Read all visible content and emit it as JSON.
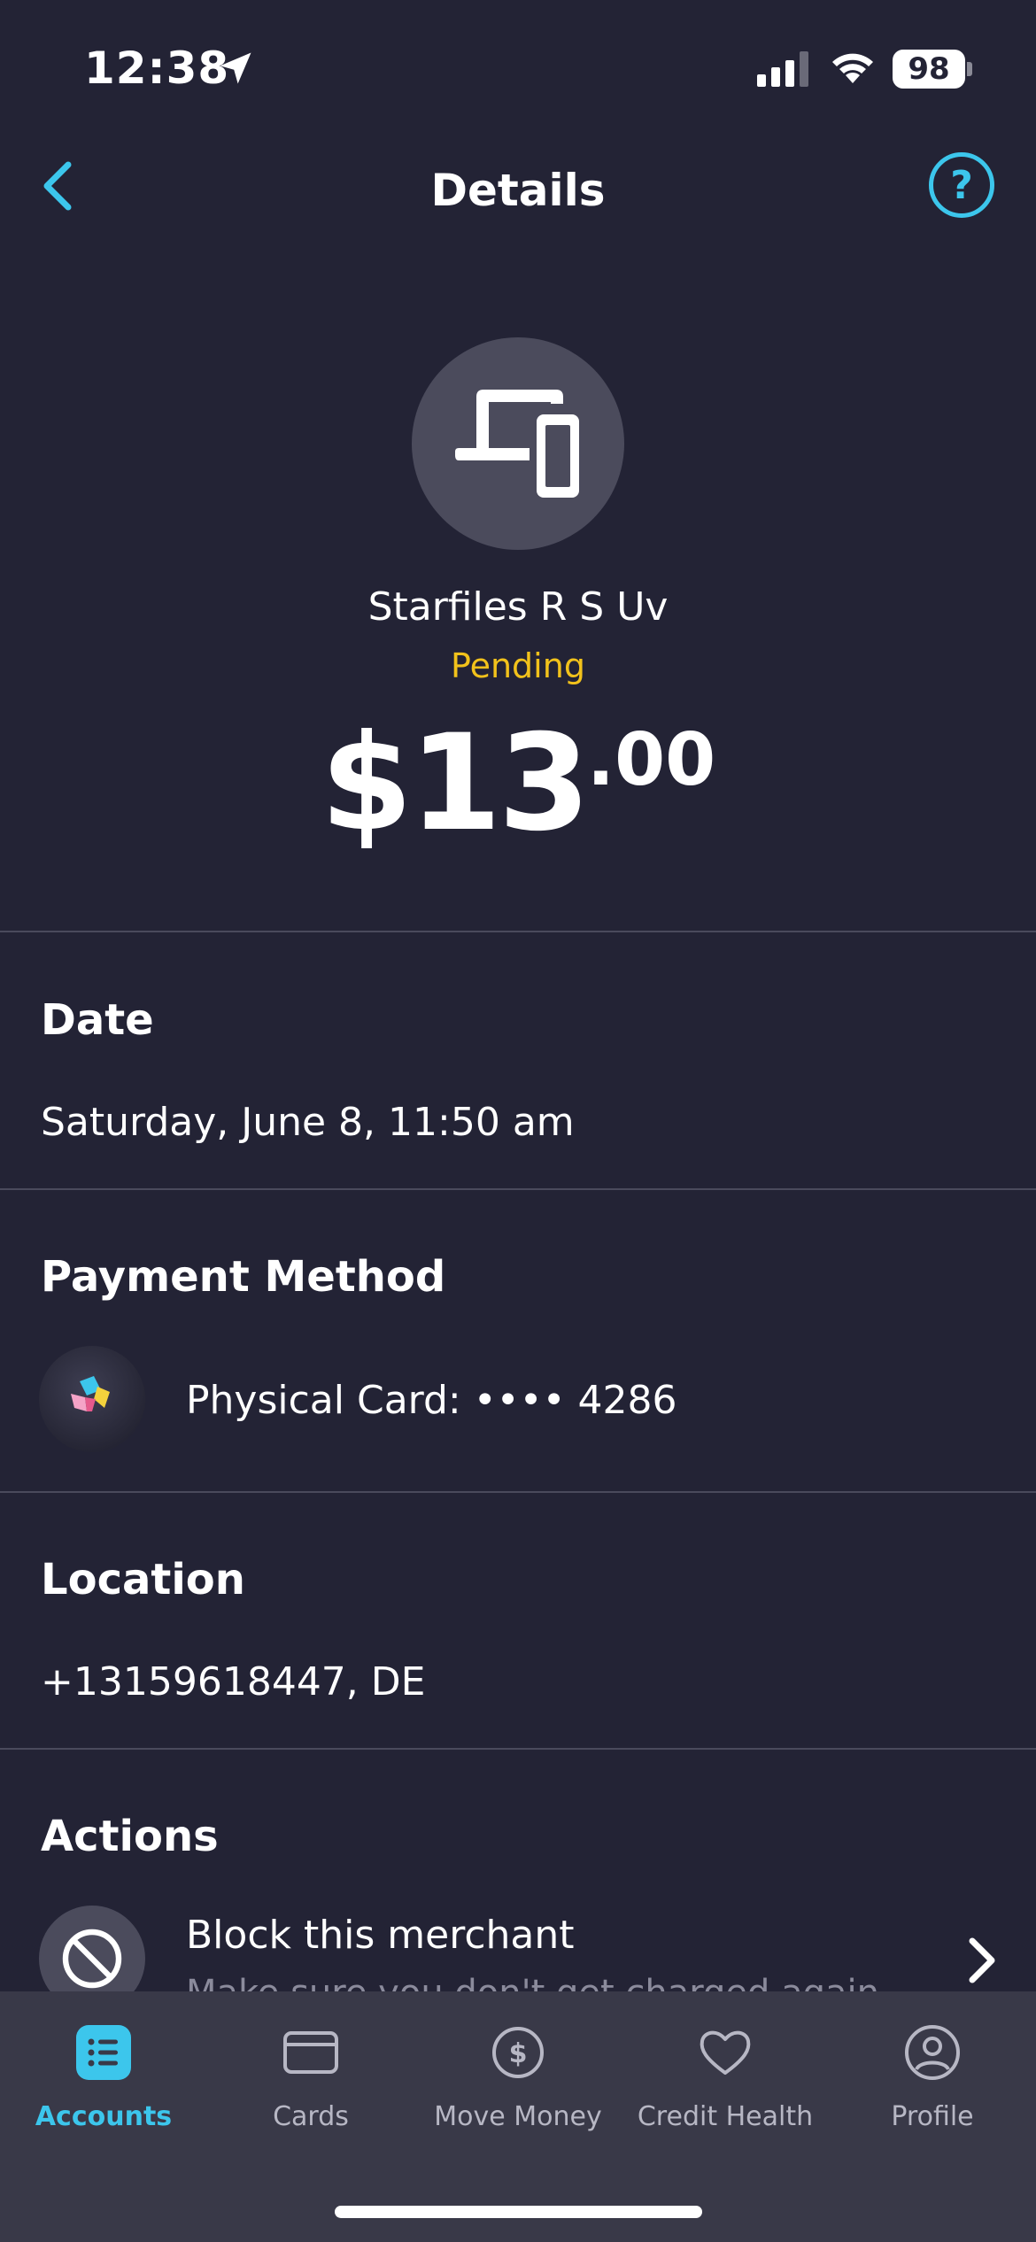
{
  "status_bar": {
    "time": "12:38",
    "battery": "98"
  },
  "nav": {
    "title": "Details",
    "help_label": "?"
  },
  "merchant": {
    "icon": "devices-icon",
    "name": "Starfiles R S Uv",
    "status": "Pending",
    "status_color": "#f2c21b",
    "amount_main": "$13",
    "amount_cents": ".00"
  },
  "sections": {
    "date": {
      "title": "Date",
      "value": "Saturday, June 8, 11:50 am"
    },
    "payment_method": {
      "title": "Payment Method",
      "value": "Physical Card: •••• 4286"
    },
    "location": {
      "title": "Location",
      "value": "+13159618447, DE"
    },
    "actions": {
      "title": "Actions",
      "items": [
        {
          "icon": "block-icon",
          "label": "Block this merchant",
          "sublabel": "Make sure you don't get charged again"
        }
      ]
    }
  },
  "tab_bar": {
    "accent_color": "#3cc6ec",
    "tabs": [
      {
        "label": "Accounts",
        "icon": "list-icon",
        "active": true
      },
      {
        "label": "Cards",
        "icon": "card-icon",
        "active": false
      },
      {
        "label": "Move Money",
        "icon": "dollar-circle-icon",
        "active": false
      },
      {
        "label": "Credit Health",
        "icon": "heart-icon",
        "active": false
      },
      {
        "label": "Profile",
        "icon": "profile-icon",
        "active": false
      }
    ]
  }
}
